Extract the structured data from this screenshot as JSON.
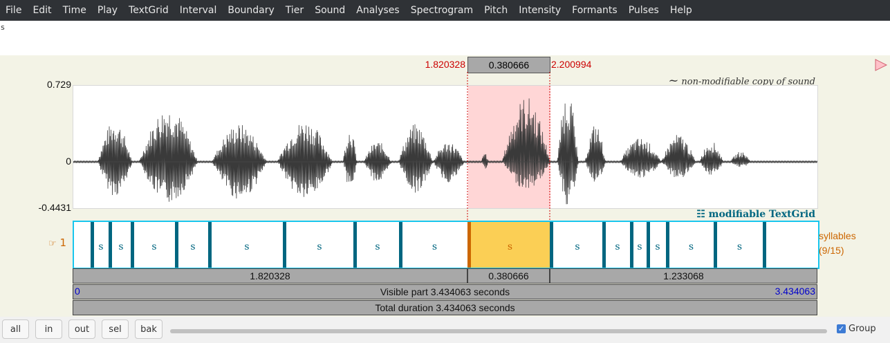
{
  "menu": [
    "File",
    "Edit",
    "Time",
    "Play",
    "TextGrid",
    "Interval",
    "Boundary",
    "Tier",
    "Sound",
    "Analyses",
    "Spectrogram",
    "Pitch",
    "Intensity",
    "Formants",
    "Pulses",
    "Help"
  ],
  "field_text": "s",
  "selection": {
    "start": "1.820328",
    "duration": "0.380666",
    "end": "2.200994"
  },
  "sound": {
    "label": "non-modifiable copy of sound",
    "ymax": "0.729",
    "yzero": "0",
    "ymin": "-0.4431"
  },
  "textgrid": {
    "label": "modifiable TextGrid",
    "tier_number": "1",
    "tier_name": "syllables",
    "tier_count": "(9/15)",
    "interval_label": "s"
  },
  "bars": {
    "left_duration": "1.820328",
    "selected_duration": "0.380666",
    "right_duration": "1.233068",
    "visible_start": "0",
    "visible_text": "Visible part 3.434063 seconds",
    "visible_end": "3.434063",
    "total_text": "Total duration 3.434063 seconds"
  },
  "buttons": {
    "all": "all",
    "in": "in",
    "out": "out",
    "sel": "sel",
    "bak": "bak"
  },
  "group_label": "Group",
  "group_checked": true,
  "colors": {
    "selection": "#ffd6d6",
    "selected_interval": "#fbcf55",
    "tier_border": "#18c6ee",
    "boundary": "#006680"
  }
}
